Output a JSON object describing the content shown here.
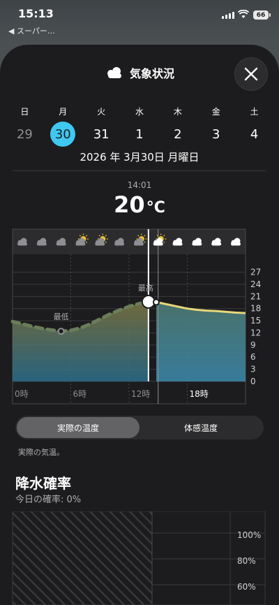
{
  "status_bar": {
    "time": "15:13",
    "back_label": "◀ スーパー…",
    "battery": "66"
  },
  "header": {
    "title": "気象状況",
    "icon": "cloud-icon",
    "close_icon": "close-icon"
  },
  "week": {
    "days": [
      {
        "dow": "日",
        "date": "29",
        "state": "prev"
      },
      {
        "dow": "月",
        "date": "30",
        "state": "selected"
      },
      {
        "dow": "火",
        "date": "31",
        "state": "normal"
      },
      {
        "dow": "水",
        "date": "1",
        "state": "normal"
      },
      {
        "dow": "木",
        "date": "2",
        "state": "normal"
      },
      {
        "dow": "金",
        "date": "3",
        "state": "normal"
      },
      {
        "dow": "土",
        "date": "4",
        "state": "normal"
      }
    ],
    "full_date": "2026 年 3月30日 月曜日"
  },
  "current": {
    "time": "14:01",
    "temp": "20",
    "unit": "°C"
  },
  "chart_data": {
    "type": "area",
    "x_label_unit": "時",
    "x_ticks": [
      "0時",
      "6時",
      "12時",
      "18時"
    ],
    "y_ticks": [
      0,
      3,
      6,
      9,
      12,
      15,
      18,
      21,
      24,
      27
    ],
    "ylim": [
      0,
      29
    ],
    "xlim": [
      0,
      24
    ],
    "current_hour": 14,
    "annotations": [
      {
        "label": "最低",
        "x": 5,
        "y": 12.4
      },
      {
        "label": "最高",
        "x": 14,
        "y": 19.7
      }
    ],
    "series": [
      {
        "x": [
          0,
          1,
          2,
          3,
          4,
          5,
          6,
          7,
          8,
          9,
          10,
          11,
          12,
          13,
          14,
          15,
          16,
          17,
          18,
          19,
          20,
          21,
          22,
          23,
          24
        ],
        "values": [
          14.8,
          14.2,
          13.6,
          13.1,
          12.7,
          12.4,
          12.6,
          13.2,
          14.2,
          15.4,
          16.6,
          17.6,
          18.5,
          19.2,
          19.7,
          19.5,
          19.0,
          18.5,
          18.0,
          17.7,
          17.5,
          17.4,
          17.2,
          17.0,
          16.9
        ]
      }
    ],
    "conditions": [
      "cloudy",
      "cloudy",
      "cloudy",
      "partly-sunny",
      "partly-sunny",
      "cloudy",
      "partly-sunny",
      "partly-sunny",
      "cloudy",
      "cloudy",
      "cloudy",
      "cloudy"
    ]
  },
  "toggle": {
    "actual": "実際の温度",
    "feels": "体感温度",
    "note": "実際の気温。"
  },
  "precipitation": {
    "title": "降水確率",
    "today": "今日の確率: 0%",
    "y_ticks": [
      "100%",
      "80%",
      "60%"
    ]
  }
}
